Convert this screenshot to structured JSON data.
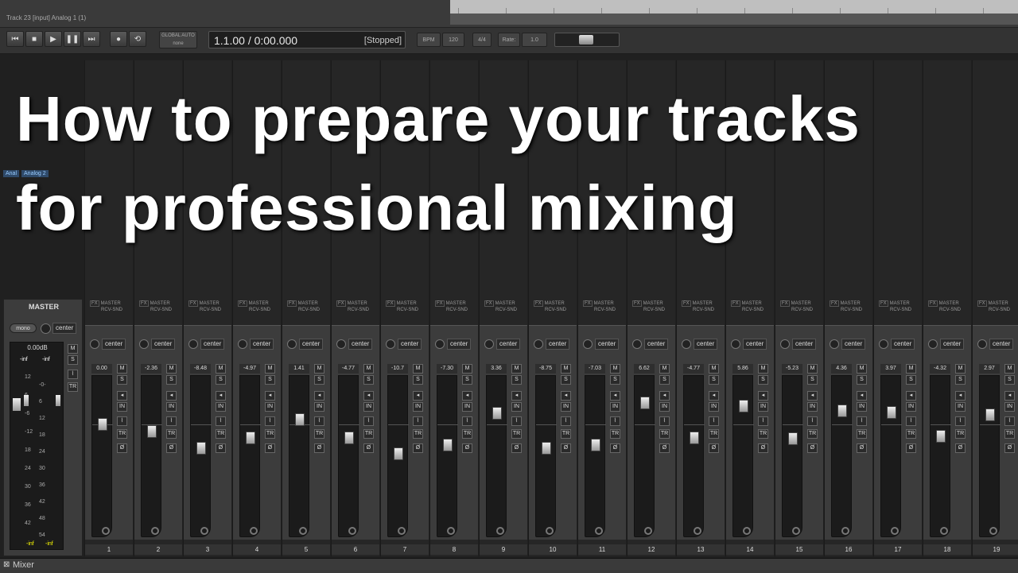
{
  "window": {
    "track_caption": "Track 23 [input] Analog 1 (1)"
  },
  "transport": {
    "buttons": [
      "⏮",
      "■",
      "▶",
      "❚❚",
      "⏭",
      "●",
      "⟲"
    ],
    "global_auto_label": "GLOBAL AUTO",
    "global_auto_value": "none",
    "time_value": "1.1.00 / 0:00.000",
    "status": "[Stopped]",
    "bpm_label": "BPM",
    "bpm_value": "120",
    "time_signature": "4/4",
    "rate_label": "Rate:",
    "rate_value": "1.0"
  },
  "overlay": {
    "line1": "How to prepare your tracks",
    "line2": "for professional mixing"
  },
  "inputs": [
    "Anal",
    "Analog 2"
  ],
  "master": {
    "label": "MASTER",
    "mono_label": "mono",
    "pan_label": "center",
    "db_value": "0.00dB",
    "peak_left": "-inf",
    "peak_right": "-inf",
    "bottom_left": "-inf",
    "bottom_right": "-inf",
    "scale": [
      "-0-",
      "6",
      "12",
      "18",
      "24",
      "30",
      "36",
      "42",
      "48",
      "54"
    ],
    "scale_left": [
      "12",
      "6",
      "-6",
      "-12",
      "18",
      "24",
      "30",
      "36",
      "42"
    ],
    "buttons": [
      "M",
      "S",
      "⌇",
      "TR"
    ]
  },
  "strip_labels": {
    "fx": "FX",
    "master": "MASTER",
    "rcv": "RCV-SND",
    "pan": "center",
    "mute": "M",
    "solo": "S",
    "in": "IN",
    "env": "⌇",
    "trim": "TR",
    "phase": "Ø"
  },
  "channels": [
    {
      "number": "1",
      "volume": "0.00",
      "fader_level": 0.72
    },
    {
      "number": "2",
      "volume": "-2.36",
      "fader_level": 0.67
    },
    {
      "number": "3",
      "volume": "-8.48",
      "fader_level": 0.56
    },
    {
      "number": "4",
      "volume": "-4.97",
      "fader_level": 0.63
    },
    {
      "number": "5",
      "volume": "1.41",
      "fader_level": 0.75
    },
    {
      "number": "6",
      "volume": "-4.77",
      "fader_level": 0.63
    },
    {
      "number": "7",
      "volume": "-10.7",
      "fader_level": 0.52
    },
    {
      "number": "8",
      "volume": "-7.30",
      "fader_level": 0.58
    },
    {
      "number": "9",
      "volume": "3.36",
      "fader_level": 0.79
    },
    {
      "number": "10",
      "volume": "-8.75",
      "fader_level": 0.56
    },
    {
      "number": "11",
      "volume": "-7.03",
      "fader_level": 0.58
    },
    {
      "number": "12",
      "volume": "6.62",
      "fader_level": 0.86
    },
    {
      "number": "13",
      "volume": "-4.77",
      "fader_level": 0.63
    },
    {
      "number": "14",
      "volume": "5.86",
      "fader_level": 0.84
    },
    {
      "number": "15",
      "volume": "-5.23",
      "fader_level": 0.62
    },
    {
      "number": "16",
      "volume": "4.36",
      "fader_level": 0.81
    },
    {
      "number": "17",
      "volume": "3.97",
      "fader_level": 0.8
    },
    {
      "number": "18",
      "volume": "-4.32",
      "fader_level": 0.64
    },
    {
      "number": "19",
      "volume": "2.97",
      "fader_level": 0.78
    }
  ],
  "footer": {
    "tab_label": "Mixer"
  }
}
